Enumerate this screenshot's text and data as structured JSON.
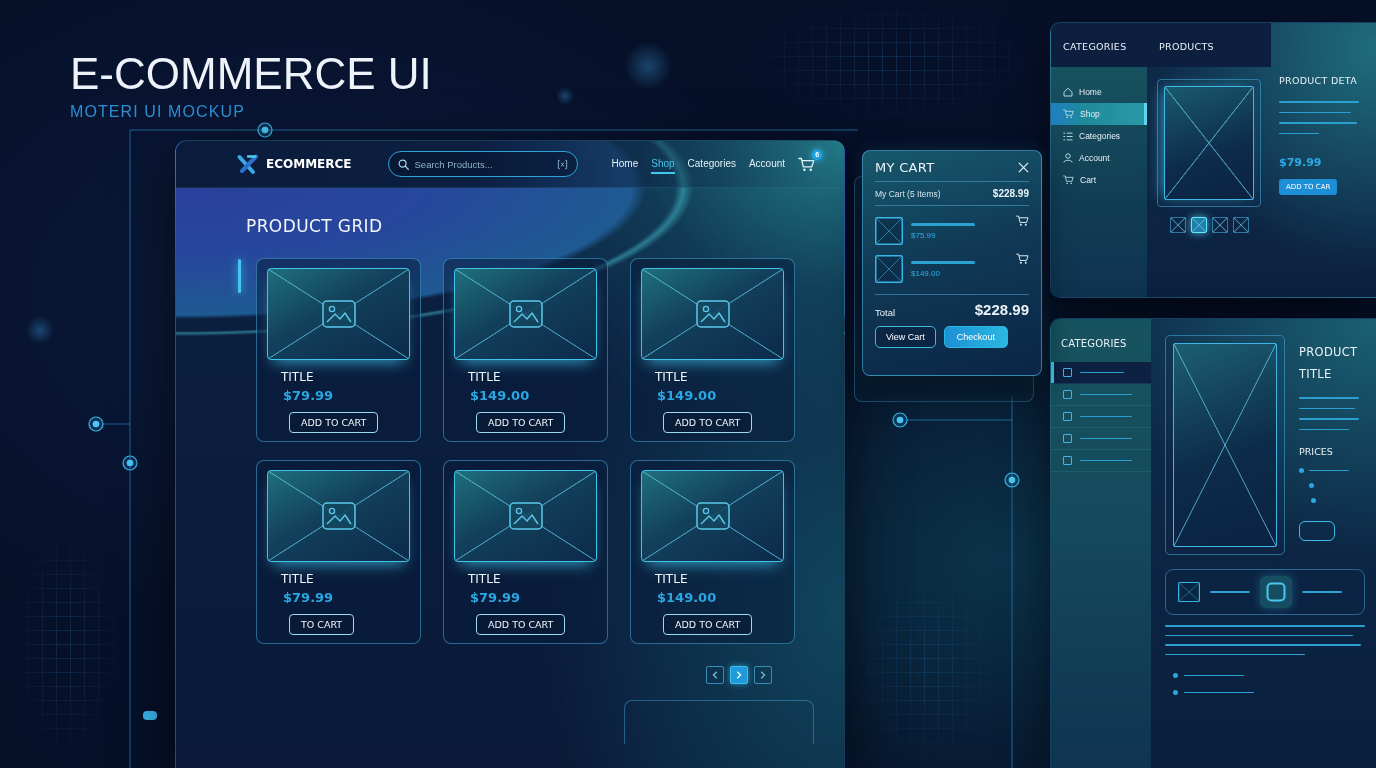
{
  "hero": {
    "title": "E-COMMERCE UI",
    "subtitle": "MOTERI UI MOCKUP"
  },
  "shop": {
    "logo": "ECOMMERCE",
    "search": {
      "placeholder": "Search Products..."
    },
    "nav": [
      {
        "label": "Home",
        "selected": false
      },
      {
        "label": "Shop",
        "selected": true
      },
      {
        "label": "Categories",
        "selected": false
      },
      {
        "label": "Account",
        "selected": false
      }
    ],
    "cart_badge": "6",
    "heading": "PRODUCT GRID",
    "products": [
      {
        "title": "TITLE",
        "price": "$79.99",
        "button": "ADD TO CART"
      },
      {
        "title": "TITLE",
        "price": "$149.00",
        "button": "ADD TO CART"
      },
      {
        "title": "TITLE",
        "price": "$149.00",
        "button": "ADD TO CART"
      },
      {
        "title": "TITLE",
        "price": "$79.99",
        "button": "TO CART"
      },
      {
        "title": "TITLE",
        "price": "$79.99",
        "button": "ADD TO CART"
      },
      {
        "title": "TITLE",
        "price": "$149.00",
        "button": "ADD TO CART"
      }
    ],
    "pagination": [
      {
        "kind": "prev",
        "selected": false
      },
      {
        "kind": "page",
        "selected": true
      },
      {
        "kind": "next",
        "selected": false
      }
    ]
  },
  "cart": {
    "title": "MY CART",
    "summary": "My Cart (5 Items)",
    "summary_total": "$228.99",
    "items": [
      {
        "price": "$75.99"
      },
      {
        "price": "$149.00"
      }
    ],
    "total_label": "Total",
    "total": "$228.99",
    "buttons": [
      {
        "label": "View Cart",
        "kind": "outline"
      },
      {
        "label": "Checkout",
        "kind": "primary"
      }
    ]
  },
  "detail": {
    "sidebar_heading": "CATEGORIES",
    "products_heading": "PRODUCTS",
    "detail_heading": "PRODUCT DETA",
    "menu": [
      {
        "label": "Home",
        "kind": "home",
        "selected": false
      },
      {
        "label": "Shop",
        "kind": "cart",
        "selected": true
      },
      {
        "label": "Categories",
        "kind": "list",
        "selected": false
      },
      {
        "label": "Account",
        "kind": "user",
        "selected": false
      },
      {
        "label": "Cart",
        "kind": "cart",
        "selected": false
      }
    ],
    "thumbnails": [
      {
        "selected": false
      },
      {
        "selected": true
      },
      {
        "selected": false
      },
      {
        "selected": false
      }
    ],
    "price": "$79.99",
    "button": "ADD TO CAR"
  },
  "filter": {
    "heading": "CATEGORIES",
    "filters": [
      {
        "checked": false,
        "selected": true
      },
      {
        "checked": false,
        "selected": false
      },
      {
        "checked": false,
        "selected": false
      },
      {
        "checked": false,
        "selected": false
      },
      {
        "checked": false,
        "selected": false
      }
    ],
    "title": "PRODUCT TITLE",
    "prices_heading": "PRICES"
  }
}
